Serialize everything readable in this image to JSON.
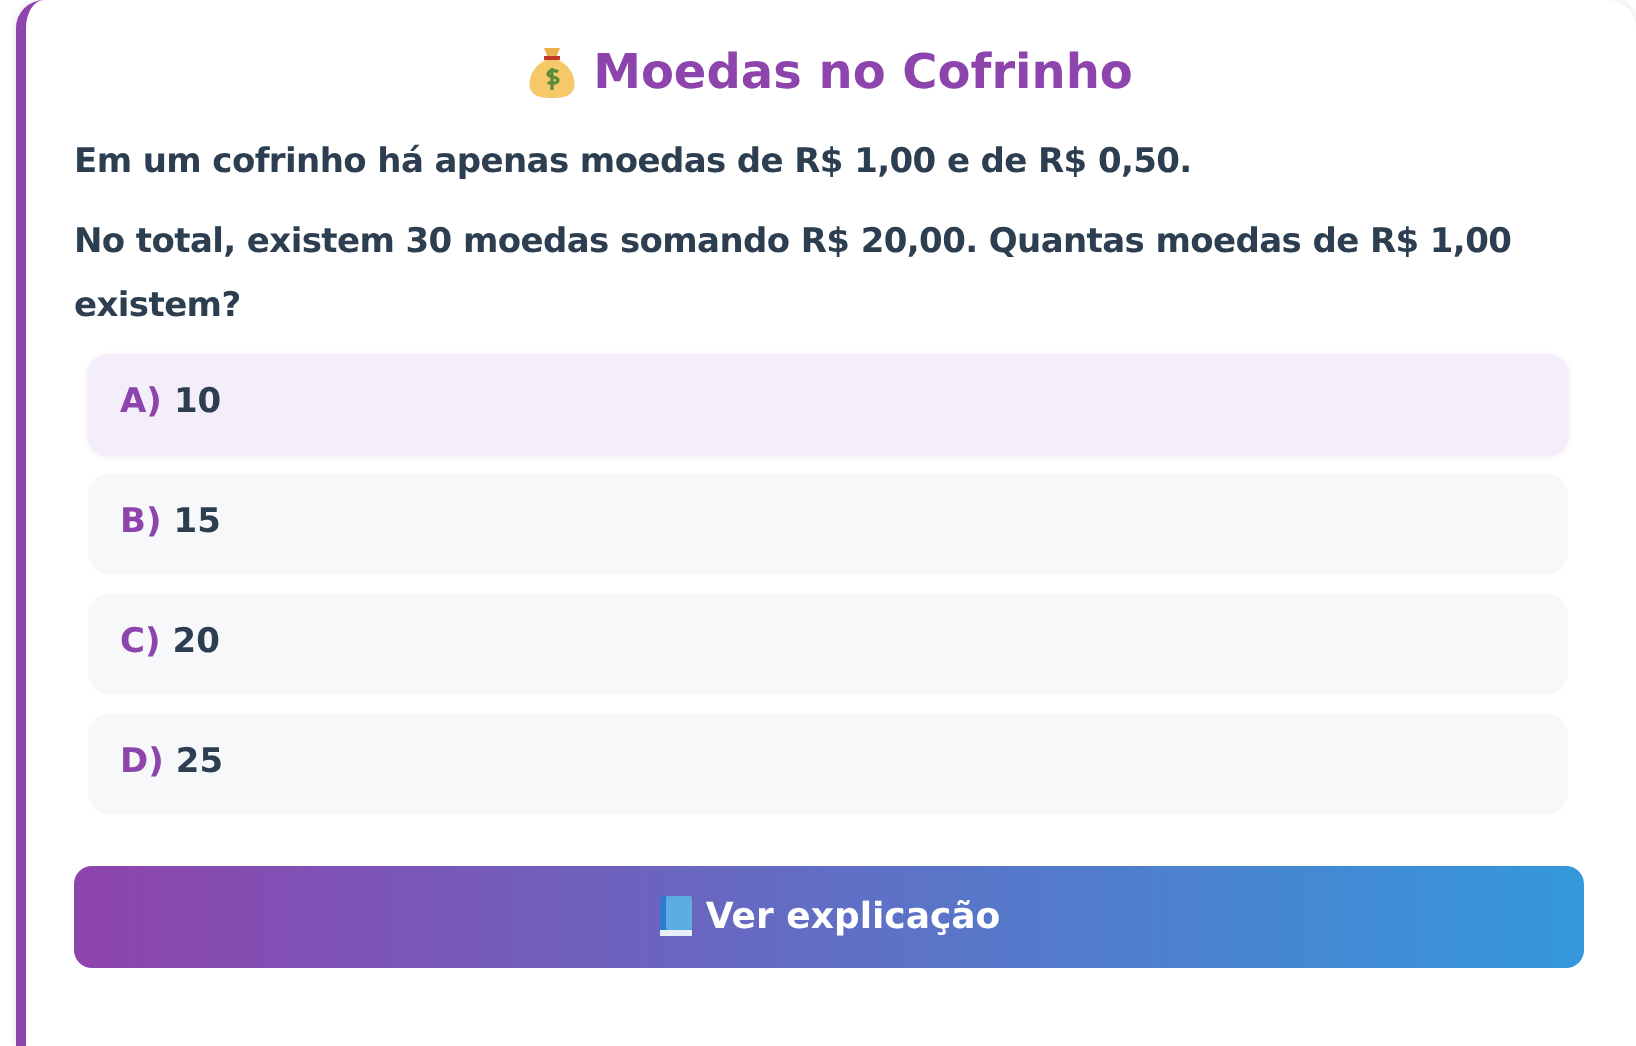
{
  "title": "Moedas no Cofrinho",
  "question": [
    "Em um cofrinho há apenas moedas de R$ 1,00 e de R$ 0,50.",
    "No total, existem 30 moedas somando R$ 20,00. Quantas moedas de R$ 1,00 existem?"
  ],
  "options": [
    {
      "letter": "A)",
      "text": "10",
      "selected": true
    },
    {
      "letter": "B)",
      "text": "15",
      "selected": false
    },
    {
      "letter": "C)",
      "text": "20",
      "selected": false
    },
    {
      "letter": "D)",
      "text": "25",
      "selected": false
    }
  ],
  "button": "Ver explicação"
}
